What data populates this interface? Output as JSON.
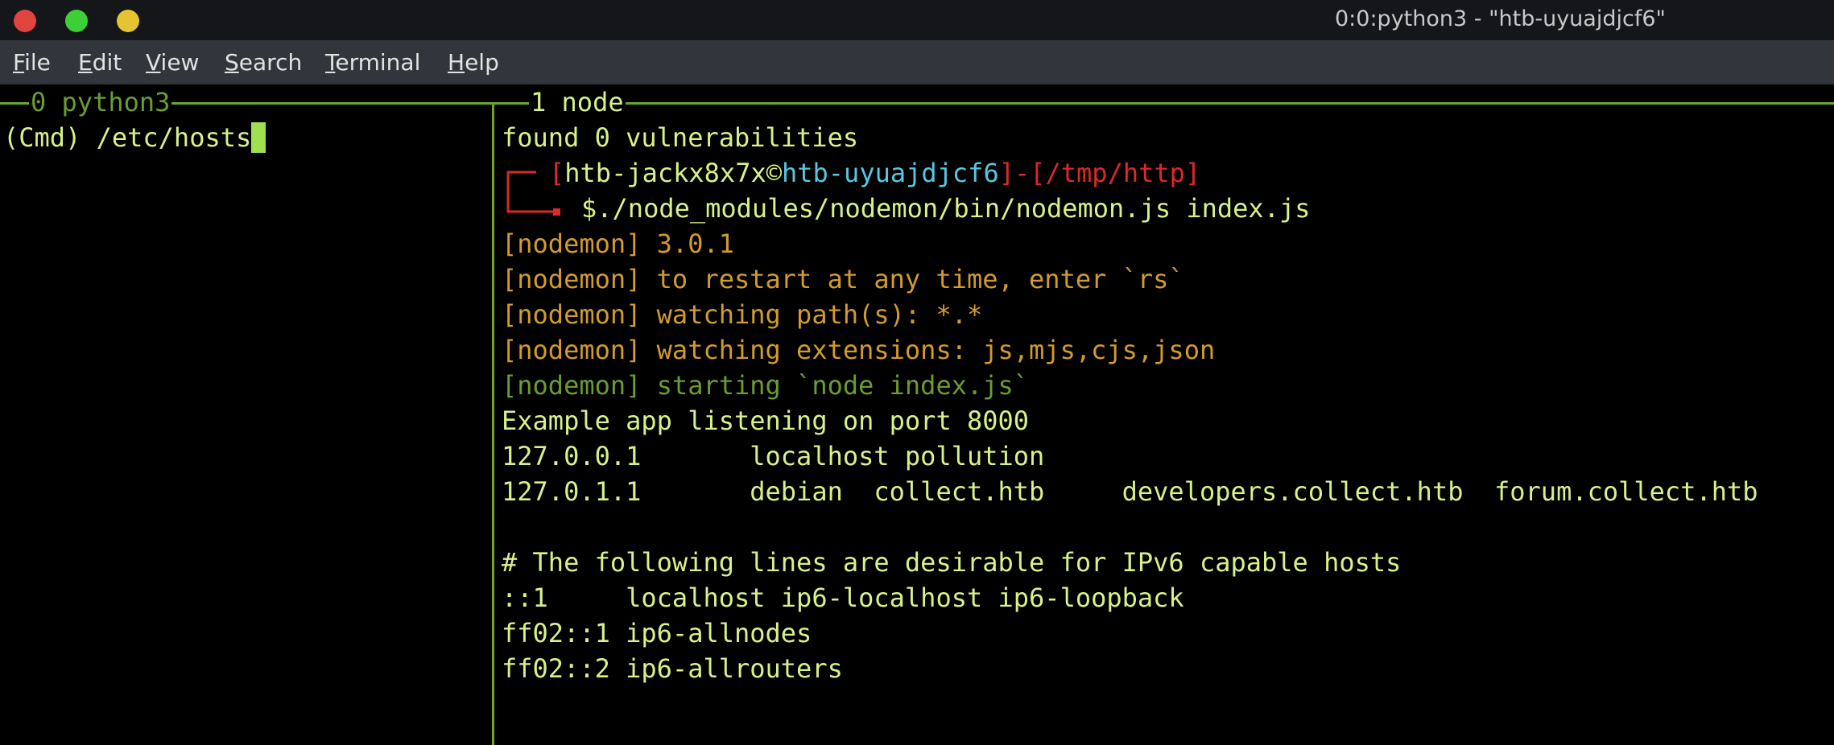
{
  "window": {
    "title": "0:0:python3 - \"htb-uyuajdjcf6\"",
    "controls": {
      "close_color": "#e0443e",
      "minimize_color": "#3ccf38",
      "maximize_color": "#e6c332"
    }
  },
  "menu": {
    "items": [
      {
        "accel": "F",
        "rest": "ile"
      },
      {
        "accel": "E",
        "rest": "dit"
      },
      {
        "accel": "V",
        "rest": "iew"
      },
      {
        "accel": "S",
        "rest": "earch"
      },
      {
        "accel": "T",
        "rest": "erminal"
      },
      {
        "accel": "H",
        "rest": "elp"
      }
    ]
  },
  "colors": {
    "border": "#6ea62a",
    "text": "#d8f28a",
    "nodemon_yellow": "#d29b2c",
    "nodemon_green": "#6a9c30",
    "prompt_red": "#dc2828",
    "prompt_cyan": "#57c7e3"
  },
  "left_pane": {
    "label": "0 python3",
    "command_line": "(Cmd) /etc/hosts"
  },
  "right_pane": {
    "label": "1 node",
    "line_vuln": "found 0 vulnerabilities",
    "prompt": {
      "bracket_open": "[",
      "user": "htb-jackx8x7x",
      "at": "©",
      "host": "htb-uyuajdjcf6",
      "bracket_close": "]",
      "dash": "-",
      "path": "[/tmp/http]",
      "command": "$./node_modules/nodemon/bin/nodemon.js index.js"
    },
    "nodemon_lines": [
      "[nodemon] 3.0.1",
      "[nodemon] to restart at any time, enter `rs`",
      "[nodemon] watching path(s): *.*",
      "[nodemon] watching extensions: js,mjs,cjs,json"
    ],
    "nodemon_start": "[nodemon] starting `node index.js`",
    "output_lines": [
      "Example app listening on port 8000",
      "127.0.0.1       localhost pollution",
      "127.0.1.1       debian  collect.htb     developers.collect.htb  forum.collect.htb",
      "",
      "# The following lines are desirable for IPv6 capable hosts",
      "::1     localhost ip6-localhost ip6-loopback",
      "ff02::1 ip6-allnodes",
      "ff02::2 ip6-allrouters"
    ]
  }
}
